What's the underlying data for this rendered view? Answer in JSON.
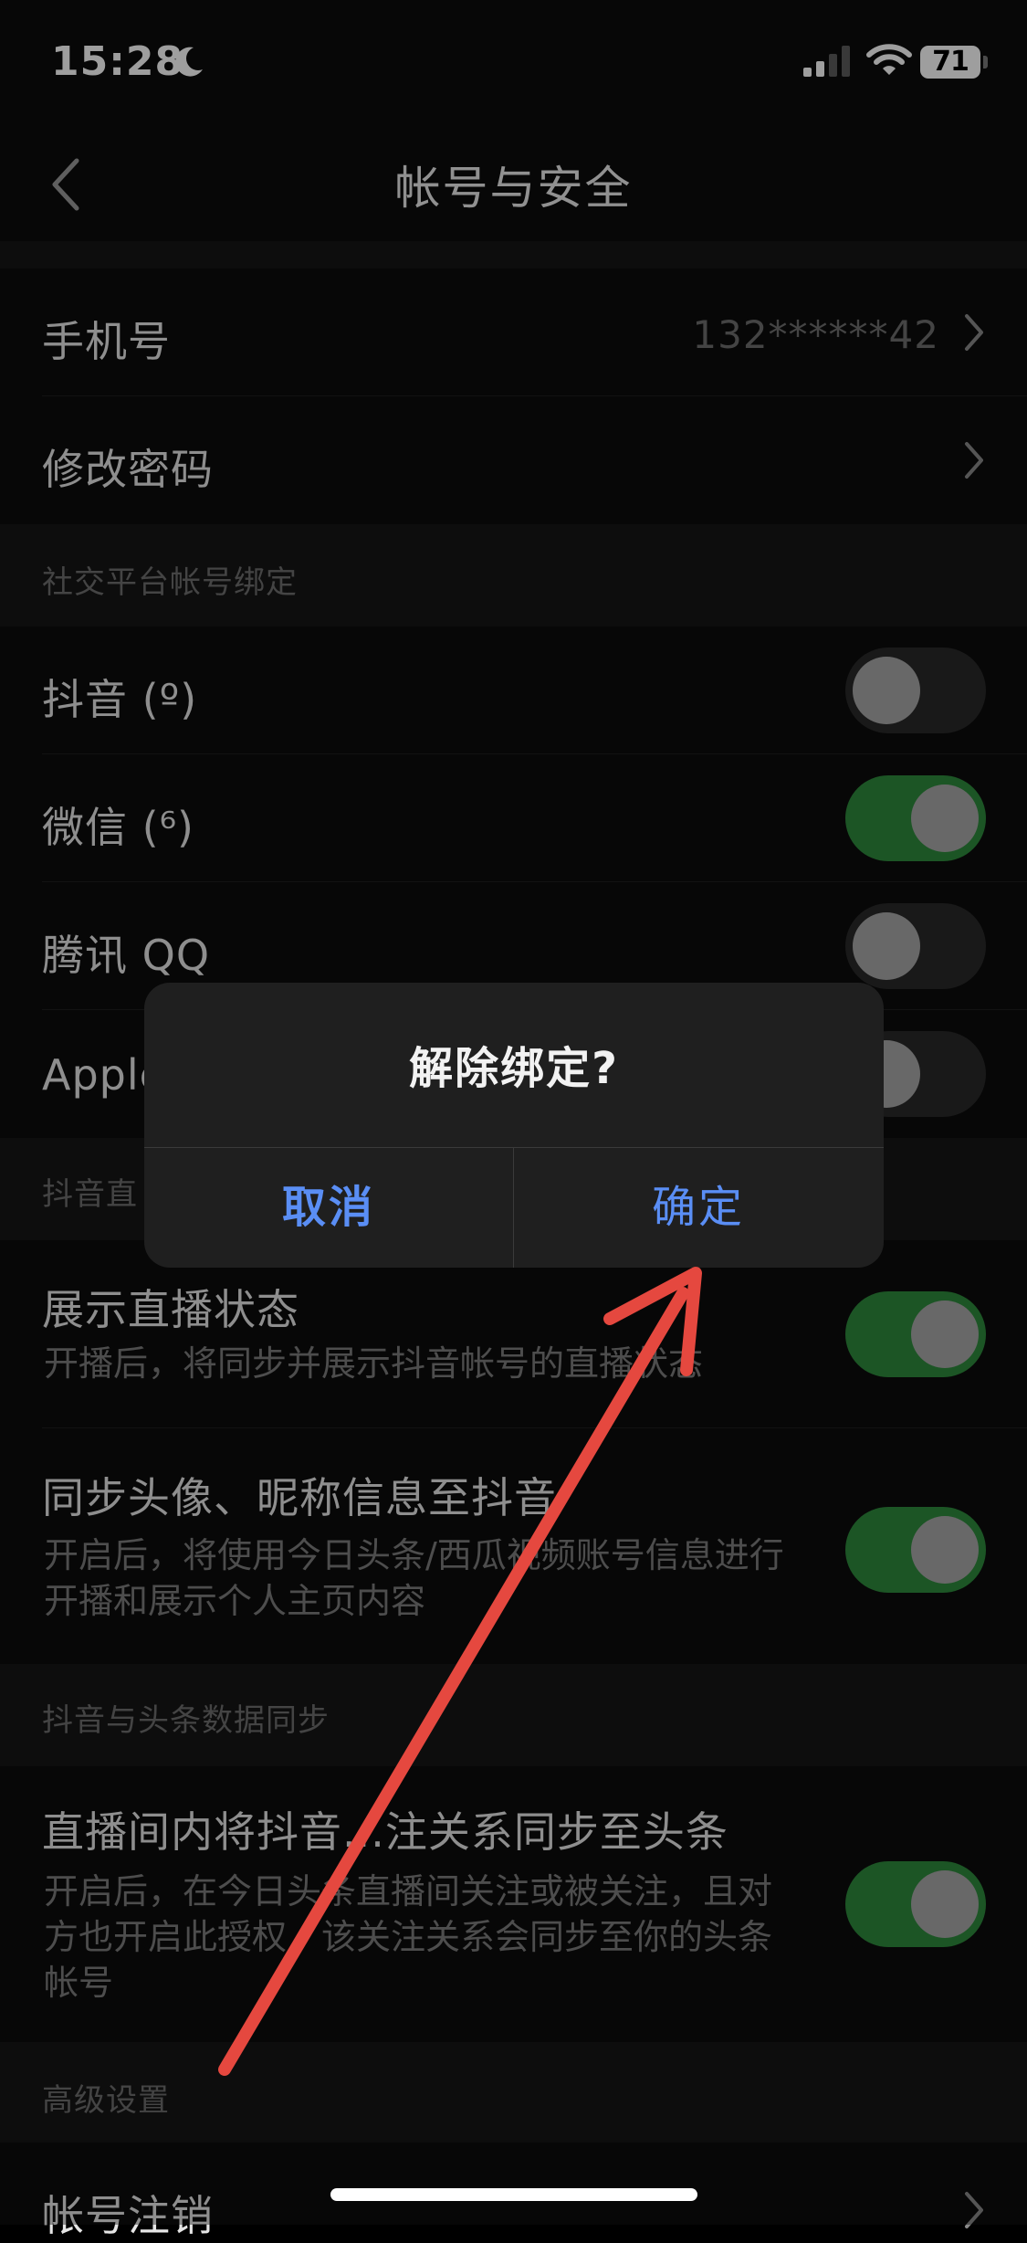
{
  "status_bar": {
    "time": "15:28",
    "battery": "71",
    "icons": [
      "moon-icon",
      "signal-icon",
      "wifi-icon",
      "battery-icon"
    ]
  },
  "nav": {
    "title": "帐号与安全",
    "back_icon": "chevron-left-icon"
  },
  "account": {
    "phone_label": "手机号",
    "phone_value": "132******42",
    "password_label": "修改密码"
  },
  "social": {
    "header": "社交平台帐号绑定",
    "items": [
      {
        "label": "抖音 (º)",
        "on": false
      },
      {
        "label": "微信 (⁶)",
        "on": true
      },
      {
        "label": "腾讯 QQ",
        "on": false
      },
      {
        "label": "Apple",
        "on": false
      }
    ]
  },
  "douyin_live": {
    "header": "抖音直",
    "items": [
      {
        "label": "展示直播状态",
        "desc": "开播后，将同步并展示抖音帐号的直播状态",
        "on": true
      },
      {
        "label": "同步头像、昵称信息至抖音",
        "desc": "开启后，将使用今日头条/西瓜视频账号信息进行开播和展示个人主页内容",
        "on": true
      }
    ]
  },
  "data_sync": {
    "header": "抖音与头条数据同步",
    "items": [
      {
        "label": "直播间内将抖音...注关系同步至头条",
        "desc": "开启后，在今日头条直播间关注或被关注，且对方也开启此授权，该关注关系会同步至你的头条帐号",
        "on": true
      }
    ]
  },
  "advanced": {
    "header": "高级设置",
    "items": [
      {
        "label": "帐号注销"
      }
    ]
  },
  "dialog": {
    "title": "解除绑定?",
    "cancel": "取消",
    "confirm": "确定"
  },
  "colors": {
    "toggle_on": "#2e8a3d",
    "toggle_off": "#292929",
    "dialog_button": "#5a8ef5",
    "annotation_arrow": "#e5483f"
  }
}
